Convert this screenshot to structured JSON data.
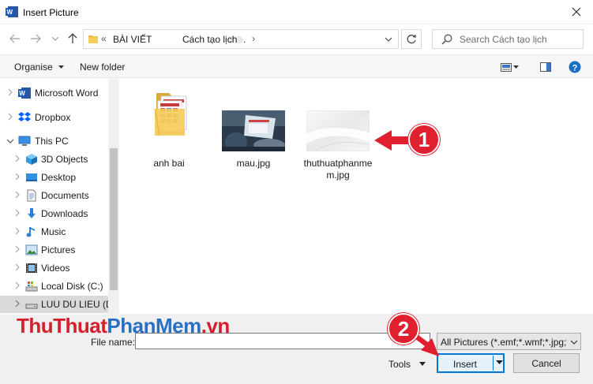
{
  "window": {
    "title": "Insert Picture"
  },
  "address": {
    "overflow": "«",
    "crumb1": "BÀI VIẾT",
    "sep_dot": ".",
    "sep": "›",
    "crumb2": "Cách tạo lịch"
  },
  "search": {
    "placeholder": "Search Cách tạo lịch"
  },
  "toolbar": {
    "organise": "Organise",
    "new_folder": "New folder"
  },
  "nav": {
    "items": [
      {
        "label": "Microsoft Word"
      },
      {
        "label": "Dropbox"
      },
      {
        "label": "This PC"
      },
      {
        "label": "3D Objects"
      },
      {
        "label": "Desktop"
      },
      {
        "label": "Documents"
      },
      {
        "label": "Downloads"
      },
      {
        "label": "Music"
      },
      {
        "label": "Pictures"
      },
      {
        "label": "Videos"
      },
      {
        "label": "Local Disk (C:)"
      },
      {
        "label": "LUU DU LIEU (D:"
      }
    ]
  },
  "files": [
    {
      "name": "anh bai",
      "kind": "folder"
    },
    {
      "name": "mau.jpg",
      "kind": "image"
    },
    {
      "name": "thuthuatphanmem.jpg",
      "kind": "image"
    }
  ],
  "watermark": {
    "part1": "ThuThuat",
    "part2": "PhanMem",
    "part3": ".vn"
  },
  "bottom": {
    "filename_label": "File name:",
    "filename_value": "",
    "filter": "All Pictures (*.emf;*.wmf;*.jpg;*.j",
    "tools": "Tools",
    "insert": "Insert",
    "cancel": "Cancel"
  },
  "callouts": {
    "one": "1",
    "two": "2"
  },
  "colors": {
    "accent": "#0078d7",
    "callout": "#e0202e",
    "watermark_red": "#d3202c",
    "watermark_blue": "#2a70c2"
  }
}
